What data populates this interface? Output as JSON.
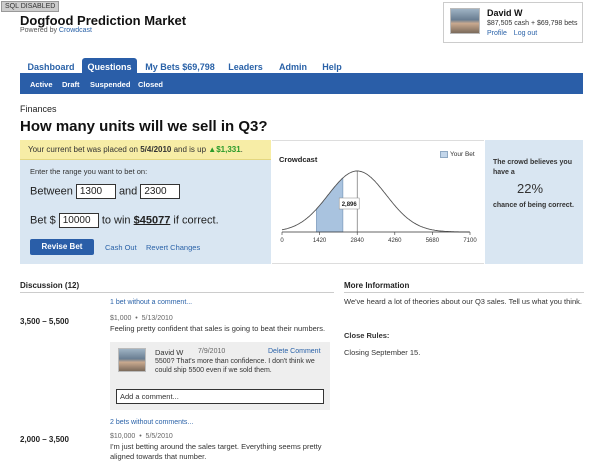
{
  "badge": "SQL DISABLED",
  "app": {
    "title": "Dogfood Prediction Market",
    "powered_prefix": "Powered by ",
    "powered_link": "Crowdcast"
  },
  "user": {
    "name": "David W",
    "cash": "$87,505 cash + $69,798 bets",
    "profile": "Profile",
    "logout": "Log out"
  },
  "nav": {
    "tabs": [
      "Dashboard",
      "Questions",
      "My Bets $69,798",
      "Leaders",
      "Admin",
      "Help"
    ],
    "active": "Questions"
  },
  "subnav": [
    "Active",
    "Draft",
    "Suspended",
    "Closed"
  ],
  "question": {
    "category": "Finances",
    "title": "How many units will we sell in Q3?"
  },
  "bet": {
    "notice_prefix": "Your current bet was placed on ",
    "notice_date": "5/4/2010",
    "notice_mid": " and is up ",
    "notice_gain": "▲$1,331",
    "notice_suffix": ".",
    "range_label": "Enter the range you want to bet on:",
    "between": "Between",
    "and": "and",
    "low": "1300",
    "high": "2300",
    "bet_prefix": "Bet $",
    "amount": "10000",
    "to_win": "to win",
    "win_amount": "$45077",
    "if_correct": "if correct.",
    "revise": "Revise Bet",
    "cash_out": "Cash Out",
    "revert": "Revert Changes"
  },
  "chart_data": {
    "type": "area",
    "title": "Crowdcast",
    "legend": "Your Bet",
    "x_ticks": [
      0,
      1420,
      2840,
      4260,
      5680,
      7100
    ],
    "xlim": [
      0,
      7100
    ],
    "distribution": {
      "shape": "normal",
      "mean": 2840,
      "sd": 1100
    },
    "bet_range": [
      1300,
      2300
    ],
    "peak_label": "2,896"
  },
  "crowd": {
    "line1": "The crowd believes you have a",
    "pct": "22%",
    "line2": "chance of being correct."
  },
  "discussion": {
    "title": "Discussion (12)",
    "groups": [
      {
        "link": "1 bet without a comment...",
        "range": "3,500 – 5,500",
        "amount": "$1,000",
        "date": "5/13/2010",
        "text": "Feeling pretty confident that sales is going to beat their numbers.",
        "reply": {
          "name": "David W",
          "date": "7/9/2010",
          "delete": "Delete Comment",
          "text": "5500? That's more than confidence. I don't think we could ship 5500 even if we sold them."
        },
        "add_placeholder": "Add a comment..."
      },
      {
        "link": "2 bets without comments...",
        "range": "2,000 – 3,500",
        "amount": "$10,000",
        "date": "5/5/2010",
        "text": "I'm just betting around the sales target. Everything seems pretty aligned towards that number."
      }
    ]
  },
  "info": {
    "title": "More Information",
    "text": "We've heard a lot of theories about our Q3 sales. Tell us what you think.",
    "close_title": "Close Rules:",
    "close_text": "Closing September 15."
  },
  "colors": {
    "primary": "#2a5ea8",
    "panel": "#d9e6f2",
    "notice": "#f7eda6",
    "gain": "#2a9a2a"
  }
}
